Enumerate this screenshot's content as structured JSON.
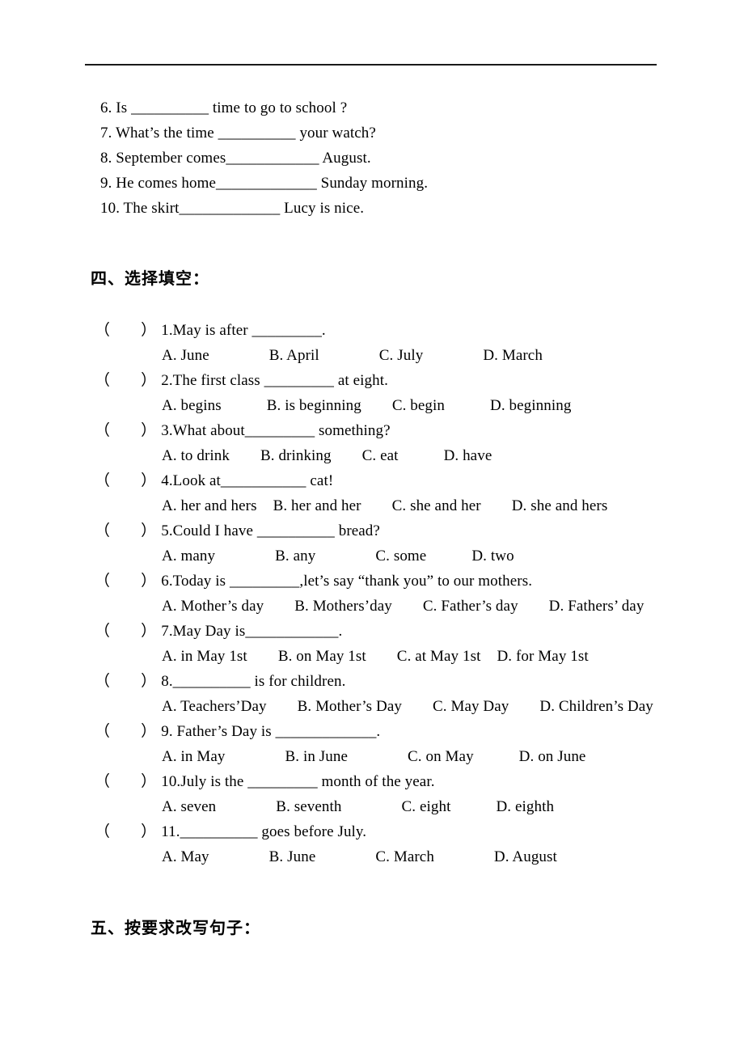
{
  "page": {
    "background": "#ffffff",
    "text_color": "#000000",
    "rule_color": "#1a1a1a"
  },
  "fill_in_section": {
    "items": [
      "6. Is __________ time to go to school ?",
      "7. What’s the time __________ your watch?",
      "8. September comes____________ August.",
      "9. He comes home_____________ Sunday morning.",
      "10. The skirt_____________ Lucy is nice."
    ]
  },
  "section_four": {
    "heading": "四、选择填空：",
    "paren_open": "（",
    "paren_close": "）",
    "questions": [
      {
        "text": "1.May is after _________.",
        "options": [
          "A. June",
          "B. April",
          "C. July",
          "D. March"
        ],
        "gaps": [
          "gap-xl",
          "gap-xl",
          "gap-xl"
        ]
      },
      {
        "text": "2.The first class _________ at eight.",
        "options": [
          "A. begins",
          "B. is beginning",
          "C. begin",
          "D. beginning"
        ],
        "gaps": [
          "gap-l",
          "gap-m",
          "gap-l"
        ]
      },
      {
        "text": "3.What about_________ something?",
        "options": [
          "A. to drink",
          "B. drinking",
          "C. eat",
          "D. have"
        ],
        "gaps": [
          "gap-m",
          "gap-m",
          "gap-l"
        ]
      },
      {
        "text": "4.Look at___________ cat!",
        "options": [
          "A. her and hers",
          "B. her and her",
          "C. she and her",
          "D. she and hers"
        ],
        "gaps": [
          "gap-s",
          "gap-m",
          "gap-m"
        ]
      },
      {
        "text": "5.Could I have __________ bread?",
        "options": [
          "A. many",
          "B. any",
          "C. some",
          "D. two"
        ],
        "gaps": [
          "gap-xl",
          "gap-xl",
          "gap-l"
        ]
      },
      {
        "text": "6.Today is _________,let’s say “thank you” to our mothers.",
        "options": [
          "A. Mother’s day",
          "B. Mothers’day",
          "C. Father’s day",
          "D. Fathers’ day"
        ],
        "gaps": [
          "gap-m",
          "gap-m",
          "gap-m"
        ]
      },
      {
        "text": "7.May Day is____________.",
        "options": [
          "A. in May 1st",
          "B. on May 1st",
          "C. at May 1st",
          "D. for May 1st"
        ],
        "gaps": [
          "gap-m",
          "gap-m",
          "gap-s"
        ]
      },
      {
        "text": "8.__________ is for children.",
        "options": [
          "A. Teachers’Day",
          "B. Mother’s Day",
          "C. May Day",
          "D. Children’s Day"
        ],
        "gaps": [
          "gap-m",
          "gap-m",
          "gap-m"
        ]
      },
      {
        "text": "9. Father’s Day is _____________.",
        "options": [
          "A. in May",
          "B. in June",
          "C. on May",
          "D. on June"
        ],
        "gaps": [
          "gap-xl",
          "gap-xl",
          "gap-l"
        ]
      },
      {
        "text": "10.July is the _________ month of the year.",
        "options": [
          "A. seven",
          "B. seventh",
          "C. eight",
          "D. eighth"
        ],
        "gaps": [
          "gap-xl",
          "gap-xl",
          "gap-l"
        ]
      },
      {
        "text": "11.__________ goes before July.",
        "options": [
          "A. May",
          "B. June",
          "C. March",
          "D. August"
        ],
        "gaps": [
          "gap-xl",
          "gap-xl",
          "gap-xl"
        ]
      }
    ]
  },
  "section_five": {
    "heading": "五、按要求改写句子："
  }
}
